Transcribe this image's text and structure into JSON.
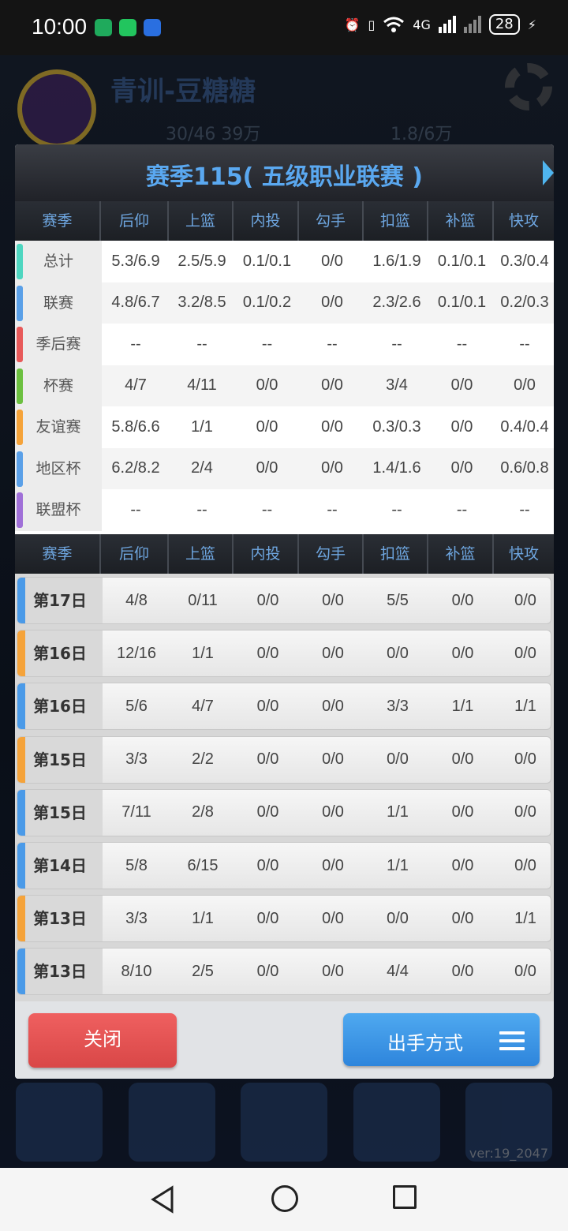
{
  "status_bar": {
    "time": "10:00",
    "network": "4G",
    "battery": "28",
    "icon_colors": [
      "#1faa5c",
      "#22c55e",
      "#2a6fe0"
    ]
  },
  "background": {
    "team_name": "青训-豆糖糖",
    "stat1": "30/46 39万",
    "stat2": "1.8/6万",
    "version": "ver:19_2047"
  },
  "panel": {
    "title": "赛季115( 五级职业联赛 )",
    "columns": [
      "赛季",
      "后仰",
      "上篮",
      "内投",
      "勾手",
      "扣篮",
      "补篮",
      "快攻"
    ],
    "summary_rows": [
      {
        "label": "总计",
        "color": "#4ed6c0",
        "values": [
          "5.3/6.9",
          "2.5/5.9",
          "0.1/0.1",
          "0/0",
          "1.6/1.9",
          "0.1/0.1",
          "0.3/0.4"
        ]
      },
      {
        "label": "联赛",
        "color": "#5aa0e8",
        "values": [
          "4.8/6.7",
          "3.2/8.5",
          "0.1/0.2",
          "0/0",
          "2.3/2.6",
          "0.1/0.1",
          "0.2/0.3"
        ]
      },
      {
        "label": "季后赛",
        "color": "#e85a5a",
        "values": [
          "--",
          "--",
          "--",
          "--",
          "--",
          "--",
          "--"
        ]
      },
      {
        "label": "杯赛",
        "color": "#6cc040",
        "values": [
          "4/7",
          "4/11",
          "0/0",
          "0/0",
          "3/4",
          "0/0",
          "0/0"
        ]
      },
      {
        "label": "友谊赛",
        "color": "#f5a33a",
        "values": [
          "5.8/6.6",
          "1/1",
          "0/0",
          "0/0",
          "0.3/0.3",
          "0/0",
          "0.4/0.4"
        ]
      },
      {
        "label": "地区杯",
        "color": "#5aa0e8",
        "values": [
          "6.2/8.2",
          "2/4",
          "0/0",
          "0/0",
          "1.4/1.6",
          "0/0",
          "0.6/0.8"
        ]
      },
      {
        "label": "联盟杯",
        "color": "#a070d8",
        "values": [
          "--",
          "--",
          "--",
          "--",
          "--",
          "--",
          "--"
        ]
      }
    ],
    "game_rows": [
      {
        "label": "第17日",
        "color": "#4a9ae8",
        "values": [
          "4/8",
          "0/11",
          "0/0",
          "0/0",
          "5/5",
          "0/0",
          "0/0"
        ]
      },
      {
        "label": "第16日",
        "color": "#f5a33a",
        "values": [
          "12/16",
          "1/1",
          "0/0",
          "0/0",
          "0/0",
          "0/0",
          "0/0"
        ]
      },
      {
        "label": "第16日",
        "color": "#4a9ae8",
        "values": [
          "5/6",
          "4/7",
          "0/0",
          "0/0",
          "3/3",
          "1/1",
          "1/1"
        ]
      },
      {
        "label": "第15日",
        "color": "#f5a33a",
        "values": [
          "3/3",
          "2/2",
          "0/0",
          "0/0",
          "0/0",
          "0/0",
          "0/0"
        ]
      },
      {
        "label": "第15日",
        "color": "#4a9ae8",
        "values": [
          "7/11",
          "2/8",
          "0/0",
          "0/0",
          "1/1",
          "0/0",
          "0/0"
        ]
      },
      {
        "label": "第14日",
        "color": "#4a9ae8",
        "values": [
          "5/8",
          "6/15",
          "0/0",
          "0/0",
          "1/1",
          "0/0",
          "0/0"
        ]
      },
      {
        "label": "第13日",
        "color": "#f5a33a",
        "values": [
          "3/3",
          "1/1",
          "0/0",
          "0/0",
          "0/0",
          "0/0",
          "1/1"
        ]
      },
      {
        "label": "第13日",
        "color": "#4a9ae8",
        "values": [
          "8/10",
          "2/5",
          "0/0",
          "0/0",
          "4/4",
          "0/0",
          "0/0"
        ]
      }
    ],
    "close_label": "关闭",
    "shot_label": "出手方式"
  }
}
